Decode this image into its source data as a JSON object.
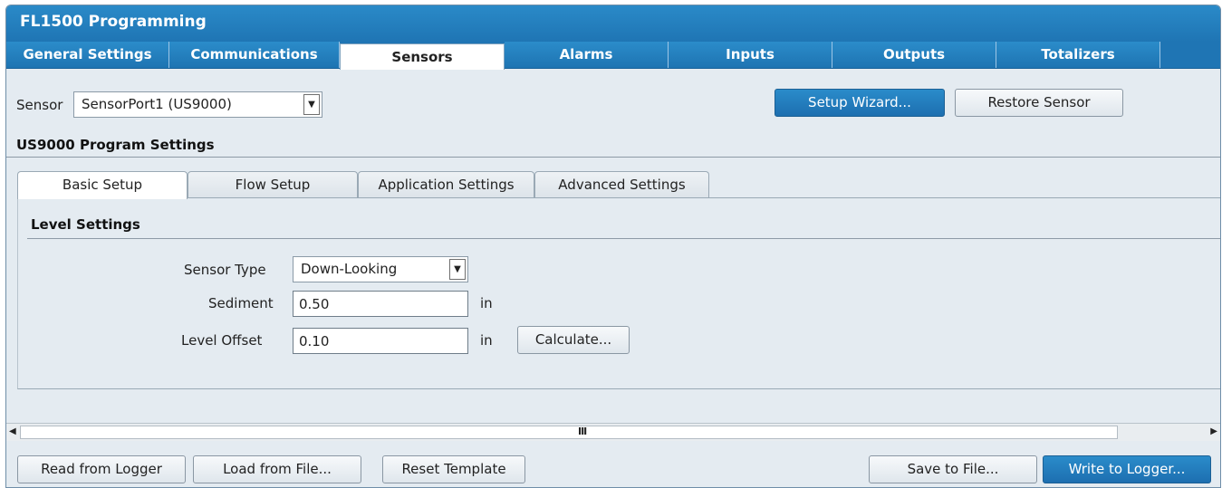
{
  "window": {
    "title": "FL1500 Programming"
  },
  "main_tabs": [
    {
      "label": "General Settings"
    },
    {
      "label": "Communications"
    },
    {
      "label": "Sensors"
    },
    {
      "label": "Alarms"
    },
    {
      "label": "Inputs"
    },
    {
      "label": "Outputs"
    },
    {
      "label": "Totalizers"
    }
  ],
  "sensor": {
    "label": "Sensor",
    "selected": "SensorPort1 (US9000)",
    "setup_wizard": "Setup Wizard...",
    "restore": "Restore Sensor"
  },
  "program_settings_title": "US9000 Program Settings",
  "sub_tabs": [
    {
      "label": "Basic Setup"
    },
    {
      "label": "Flow Setup"
    },
    {
      "label": "Application Settings"
    },
    {
      "label": "Advanced Settings"
    }
  ],
  "level": {
    "title": "Level Settings",
    "sensor_type_label": "Sensor Type",
    "sensor_type_value": "Down-Looking",
    "sediment_label": "Sediment",
    "sediment_value": "0.50",
    "sediment_unit": "in",
    "offset_label": "Level Offset",
    "offset_value": "0.10",
    "offset_unit": "in",
    "calculate": "Calculate..."
  },
  "scrollbar": {
    "grip": "III"
  },
  "bottom_buttons": {
    "read": "Read from Logger",
    "load": "Load from File...",
    "reset": "Reset Template",
    "save": "Save to File...",
    "write": "Write to Logger..."
  }
}
